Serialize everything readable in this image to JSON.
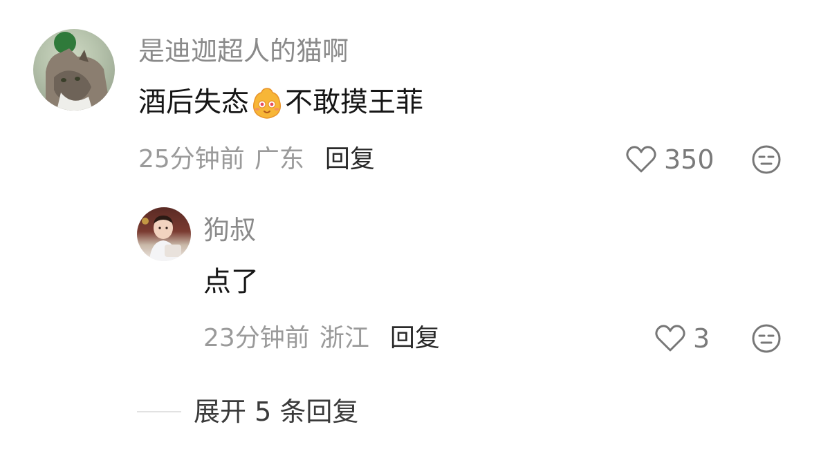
{
  "comment": {
    "username": "是迪迦超人的猫啊",
    "content_before": "酒后失态",
    "emoji_icon": "shy-blush-emoji",
    "content_after": "不敢摸王菲",
    "time": "25分钟前",
    "location": "广东",
    "reply_label": "回复",
    "likes": "350"
  },
  "reply": {
    "username": "狗叔",
    "content": "点了",
    "time": "23分钟前",
    "location": "浙江",
    "reply_label": "回复",
    "likes": "3"
  },
  "expand": {
    "label": "展开 5 条回复"
  },
  "colors": {
    "username": "#8a8a8a",
    "text": "#161616",
    "meta": "#9a9a9a",
    "icon": "#777777"
  }
}
